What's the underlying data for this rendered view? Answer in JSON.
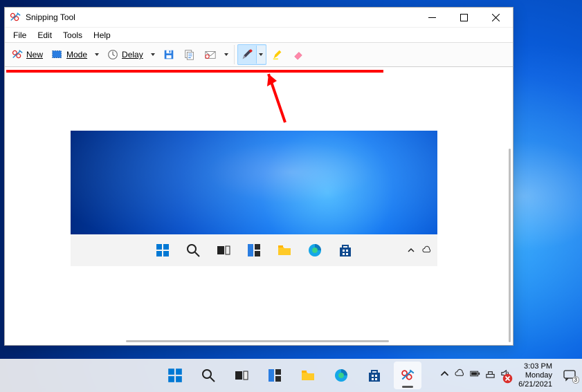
{
  "window": {
    "title": "Snipping Tool",
    "menu": {
      "file": "File",
      "edit": "Edit",
      "tools": "Tools",
      "help": "Help"
    },
    "toolbar": {
      "new": "New",
      "mode": "Mode",
      "delay": "Delay"
    }
  },
  "taskbar": {
    "time": "3:03 PM",
    "day": "Monday",
    "date": "6/21/2021",
    "notif_count": "3"
  }
}
